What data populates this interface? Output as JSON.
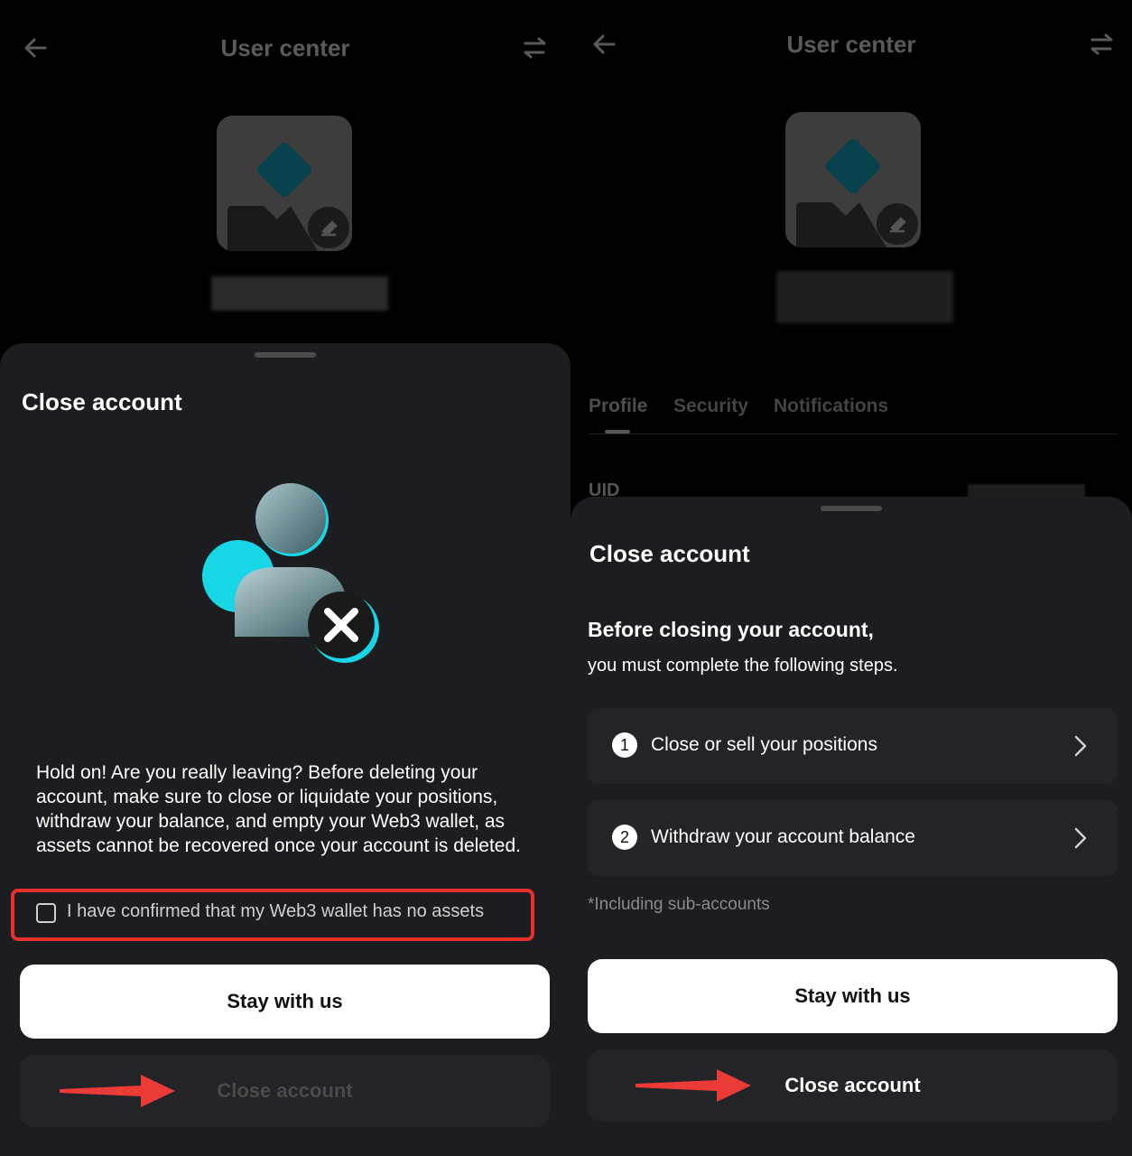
{
  "left": {
    "header": {
      "title": "User center"
    },
    "sheet": {
      "title": "Close account",
      "warning": "Hold on! Are you really leaving? Before deleting your account, make sure to close or liquidate your positions, withdraw your balance, and empty your Web3 wallet, as assets cannot be recovered once your account is deleted.",
      "confirm_label": "I have confirmed that my Web3 wallet has no assets",
      "confirm_checked": false,
      "stay_label": "Stay with us",
      "close_label": "Close account"
    }
  },
  "right": {
    "header": {
      "title": "User center"
    },
    "tabs": [
      "Profile",
      "Security",
      "Notifications"
    ],
    "active_tab": "Profile",
    "uid_label": "UID",
    "sheet": {
      "title": "Close account",
      "before_title": "Before closing your account,",
      "before_sub": "you must complete the following steps.",
      "steps": [
        {
          "num": "1",
          "label": "Close or sell your positions"
        },
        {
          "num": "2",
          "label": "Withdraw your account balance"
        }
      ],
      "footnote": "*Including sub-accounts",
      "stay_label": "Stay with us",
      "close_label": "Close account"
    }
  },
  "colors": {
    "accent_red": "#e8312f",
    "sheet_bg": "#1c1d20",
    "button_dark": "#232427",
    "teal": "#17d6e6"
  },
  "icons": [
    "back-arrow-icon",
    "swap-icon",
    "edit-icon",
    "user-remove-icon",
    "arrow-pointer-icon",
    "chevron-right-icon"
  ]
}
